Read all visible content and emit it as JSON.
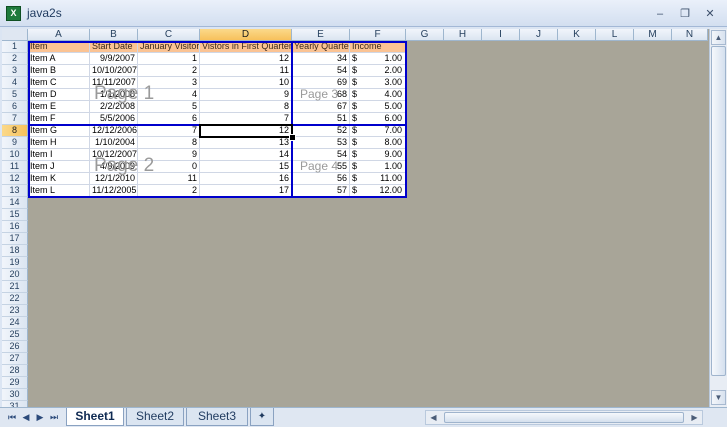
{
  "window": {
    "title": "java2s",
    "app_icon_glyph": "X",
    "minimize": "–",
    "restore": "❐",
    "close": "✕"
  },
  "columns": [
    "A",
    "B",
    "C",
    "D",
    "E",
    "F",
    "G",
    "H",
    "I",
    "J",
    "K",
    "L",
    "M",
    "N"
  ],
  "selected_column": "D",
  "selected_row": 8,
  "row_count": 31,
  "header_row": [
    "Item",
    "Start Date",
    "January Visitors",
    "Vistors in First Quarter",
    "Yearly Quarter",
    "Income"
  ],
  "rows": [
    [
      "Item A",
      "9/9/2007",
      "1",
      "12",
      "34",
      "$",
      "1.00"
    ],
    [
      "Item B",
      "10/10/2007",
      "2",
      "11",
      "54",
      "$",
      "2.00"
    ],
    [
      "Item C",
      "11/11/2007",
      "3",
      "10",
      "69",
      "$",
      "3.00"
    ],
    [
      "Item D",
      "1/1/2008",
      "4",
      "9",
      "68",
      "$",
      "4.00"
    ],
    [
      "Item E",
      "2/2/2008",
      "5",
      "8",
      "67",
      "$",
      "5.00"
    ],
    [
      "Item F",
      "5/5/2006",
      "6",
      "7",
      "51",
      "$",
      "6.00"
    ],
    [
      "Item G",
      "12/12/2006",
      "7",
      "12",
      "52",
      "$",
      "7.00"
    ],
    [
      "Item H",
      "1/10/2004",
      "8",
      "13",
      "53",
      "$",
      "8.00"
    ],
    [
      "Item I",
      "10/12/2007",
      "9",
      "14",
      "54",
      "$",
      "9.00"
    ],
    [
      "Item J",
      "4/9/2009",
      "0",
      "15",
      "55",
      "$",
      "1.00"
    ],
    [
      "Item K",
      "12/1/2010",
      "11",
      "16",
      "56",
      "$",
      "11.00"
    ],
    [
      "Item L",
      "11/12/2005",
      "2",
      "17",
      "57",
      "$",
      "12.00"
    ]
  ],
  "page_watermarks": [
    "Page 1",
    "Page 2",
    "Page 3",
    "Page 4"
  ],
  "sheet_tabs": [
    "Sheet1",
    "Sheet2",
    "Sheet3"
  ],
  "active_sheet": "Sheet1",
  "colors": {
    "page_break": "#0000cc",
    "header_fill": "#fbc393",
    "selected_header": "#f7c15c",
    "outside_print_area": "#a8a598"
  },
  "icons": {
    "nav_first": "first-sheet-icon",
    "nav_prev": "prev-sheet-icon",
    "nav_next": "next-sheet-icon",
    "nav_last": "last-sheet-icon",
    "insert_sheet": "insert-sheet-icon"
  }
}
